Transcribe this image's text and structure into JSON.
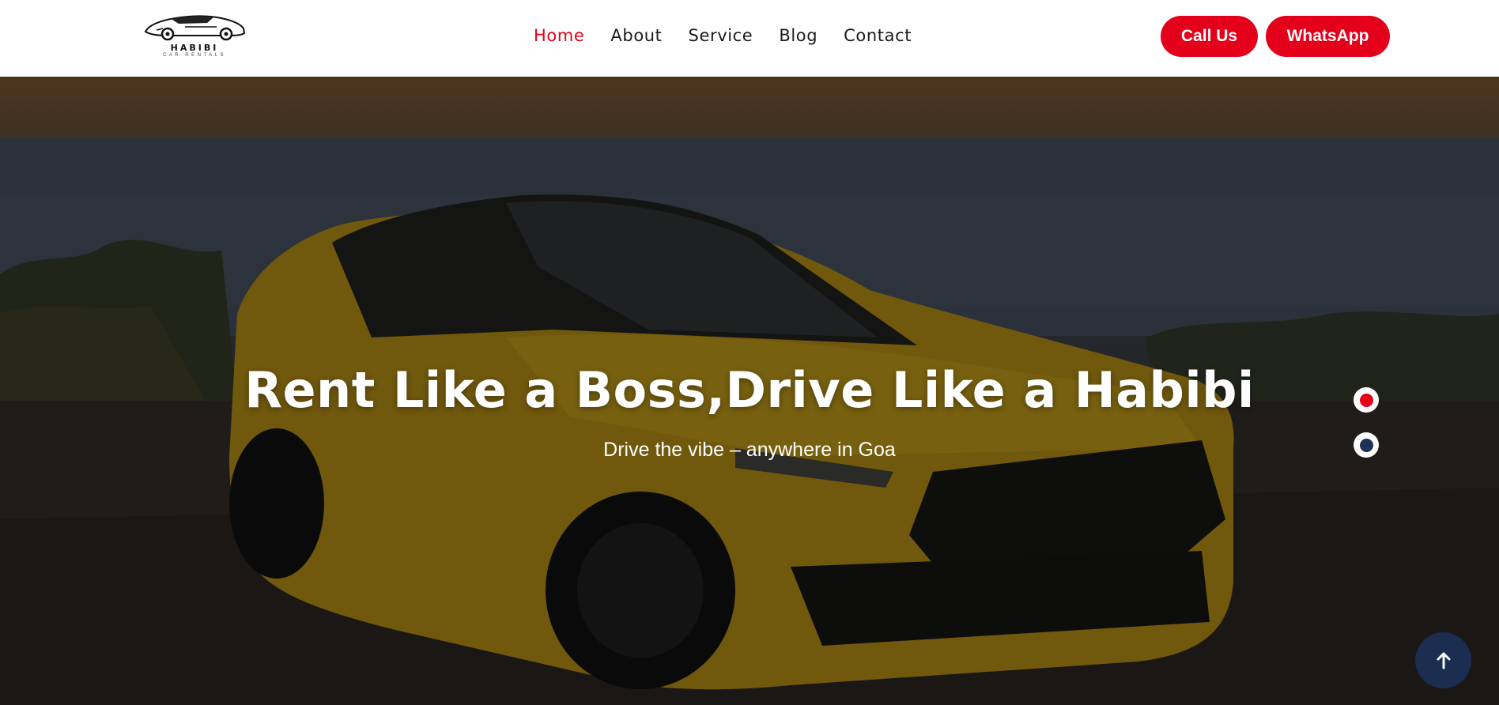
{
  "brand": {
    "name": "HABIBI",
    "tagline": "CAR RENTALS",
    "logo_icon": "sports-car-logo-icon"
  },
  "nav": {
    "items": [
      {
        "label": "Home",
        "active": true
      },
      {
        "label": "About",
        "active": false
      },
      {
        "label": "Service",
        "active": false
      },
      {
        "label": "Blog",
        "active": false
      },
      {
        "label": "Contact",
        "active": false
      }
    ]
  },
  "header_buttons": {
    "call_label": "Call Us",
    "whatsapp_label": "WhatsApp"
  },
  "hero": {
    "title": "Rent Like a Boss,Drive Like a Habibi",
    "subtitle": "Drive the vibe – anywhere in Goa",
    "slides": 2,
    "active_slide": 1
  },
  "scroll_top_icon": "arrow-up-icon",
  "colors": {
    "accent": "#e4001b",
    "navy": "#1c2d52",
    "car_yellow": "#c9a21a"
  }
}
